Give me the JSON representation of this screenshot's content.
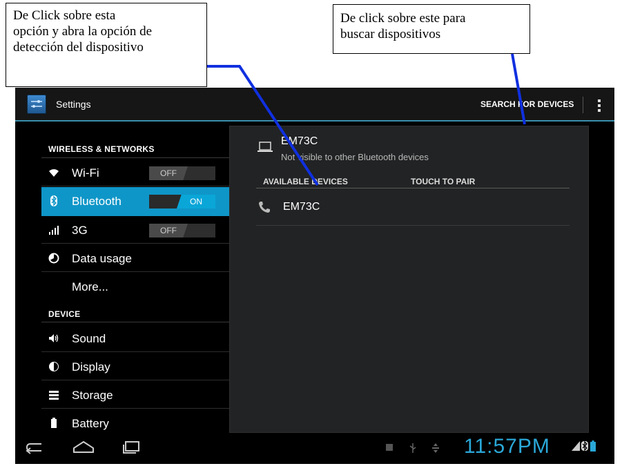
{
  "callouts": {
    "left_lines": [
      "De Click sobre esta",
      "opción y abra la opción de",
      "detección del dispositivo"
    ],
    "right_lines": [
      "De click sobre este para",
      "buscar dispositivos"
    ]
  },
  "actionbar": {
    "title": "Settings",
    "search_label": "SEARCH FOR DEVICES",
    "settings_icon": "settings-icon",
    "overflow_icon": "overflow-menu-icon"
  },
  "sidebar": {
    "wireless_header": "WIRELESS & NETWORKS",
    "device_header": "DEVICE",
    "items": [
      {
        "label": "Wi-Fi",
        "icon": "wifi-icon",
        "toggle": "OFF"
      },
      {
        "label": "Bluetooth",
        "icon": "bluetooth-icon",
        "toggle": "ON",
        "selected": true
      },
      {
        "label": "3G",
        "icon": "signal-icon",
        "toggle": "OFF"
      },
      {
        "label": "Data usage",
        "icon": "data-usage-icon"
      },
      {
        "label": "More...",
        "icon": ""
      },
      {
        "label": "Sound",
        "icon": "speaker-icon"
      },
      {
        "label": "Display",
        "icon": "display-icon"
      },
      {
        "label": "Storage",
        "icon": "storage-icon"
      },
      {
        "label": "Battery",
        "icon": "battery-icon"
      }
    ]
  },
  "bluetooth": {
    "device_name": "EM73C",
    "device_status": "Not visible to other Bluetooth devices",
    "available_header": "AVAILABLE DEVICES",
    "touch_header": "TOUCH TO PAIR",
    "available": [
      {
        "name": "EM73C",
        "icon": "phone-icon"
      }
    ]
  },
  "statusbar": {
    "clock": "11:57PM",
    "nav_icons": [
      "back-icon",
      "home-icon",
      "recent-apps-icon"
    ]
  },
  "colors": {
    "accent": "#0f96c8",
    "clock": "#2aa8d8",
    "pointer_line": "#1030e0"
  }
}
